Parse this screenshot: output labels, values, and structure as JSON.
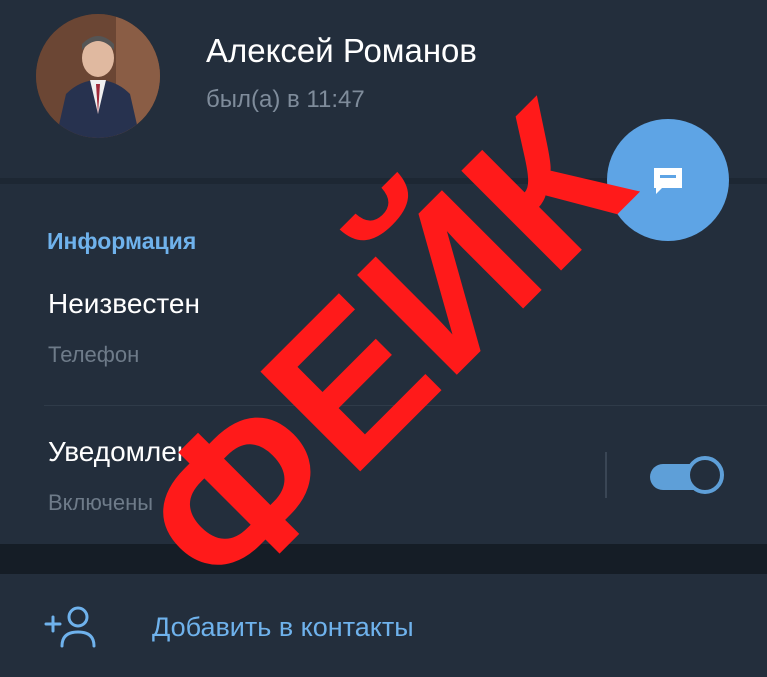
{
  "profile": {
    "name": "Алексей Романов",
    "status": "был(а) в 11:47"
  },
  "info": {
    "section_title": "Информация",
    "phone_value": "Неизвестен",
    "phone_caption": "Телефон",
    "notifications_label": "Уведомления",
    "notifications_caption": "Включены",
    "notifications_enabled": true
  },
  "actions": {
    "add_contact_label": "Добавить в контакты"
  },
  "overlay": {
    "stamp_text": "ФЕЙК",
    "stamp_color": "#ff1a1a"
  },
  "colors": {
    "accent": "#6fb2ec",
    "background": "#1d2733",
    "card": "#232e3c"
  },
  "icons": {
    "fab": "message-icon",
    "add": "add-user-icon"
  }
}
